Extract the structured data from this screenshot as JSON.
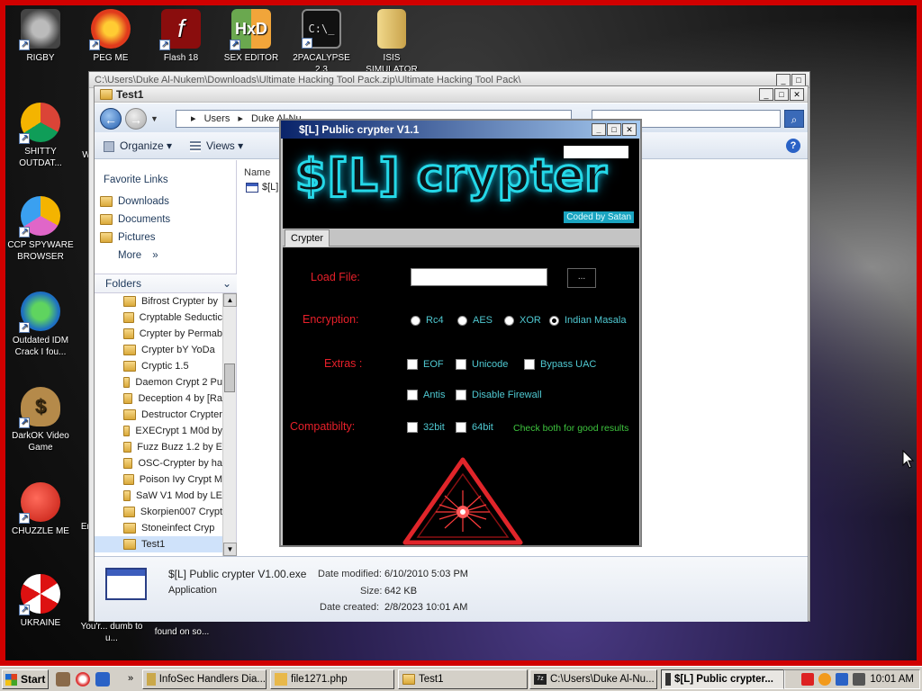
{
  "colors": {
    "desktop_border": "#d00000",
    "crypter_bg": "#000000",
    "crypter_label": "#e8202a",
    "crypter_option": "#4fc9d2",
    "crypter_hint": "#3ec53e",
    "logo_glow": "#25d8e8"
  },
  "desktop": {
    "icons": [
      {
        "label": "RIGBY",
        "icon": "raccoon-icon"
      },
      {
        "label": "PEG ME",
        "icon": "peg-icon"
      },
      {
        "label": "Flash 18",
        "icon": "flash-icon"
      },
      {
        "label": "SEX EDITOR",
        "icon": "hex-editor-icon"
      },
      {
        "label": "2PACALYPSE 2.3",
        "icon": "terminal-icon"
      },
      {
        "label": "ISIS SIMULATOR",
        "icon": "folder-icon"
      },
      {
        "label": "SHITTY OUTDAT...",
        "icon": "chrome-icon"
      },
      {
        "label": "CCP SPYWARE BROWSER",
        "icon": "chrome-canary-icon"
      },
      {
        "label": "Outdated IDM Crack I fou...",
        "icon": "idm-icon"
      },
      {
        "label": "DarkOK Video Game",
        "icon": "money-bag-icon"
      },
      {
        "label": "CHUZZLE ME",
        "icon": "chuzzle-icon"
      },
      {
        "label": "UKRAINE",
        "icon": "radiation-icon"
      },
      {
        "label": "W",
        "icon": "partial-icon"
      },
      {
        "label": "En",
        "icon": "partial-icon"
      },
      {
        "label": "You'r... dumb to u...",
        "icon": "partial-icon"
      },
      {
        "label": "found on so...",
        "icon": "partial-icon"
      }
    ]
  },
  "explorer": {
    "back_window_title": "C:\\Users\\Duke Al-Nukem\\Downloads\\Ultimate Hacking Tool Pack.zip\\Ultimate Hacking Tool Pack\\",
    "title": "Test1",
    "breadcrumb": [
      "Users",
      "Duke Al-Nu..."
    ],
    "organize_label": "Organize",
    "views_label": "Views",
    "favorite_links_title": "Favorite Links",
    "favorites": [
      "Downloads",
      "Documents",
      "Pictures"
    ],
    "more_label": "More",
    "folders_label": "Folders",
    "folders": [
      "Bifrost Crypter by",
      "Cryptable Seductic",
      "Crypter by Permab",
      "Crypter bY YoDa",
      "Cryptic 1.5",
      "Daemon Crypt 2 Pu",
      "Deception 4 by [Ra",
      "Destructor Crypter",
      "EXECrypt 1 M0d by",
      "Fuzz Buzz 1.2 by E",
      "OSC-Crypter by ha",
      "Poison Ivy Crypt M",
      "SaW V1 Mod by LE",
      "Skorpien007 Crypt",
      "Stoneinfect Cryp",
      "Test1"
    ],
    "name_column": "Name",
    "file_short_name": "$[L]",
    "details": {
      "file_name": "$[L] Public crypter V1.00.exe",
      "file_type": "Application",
      "date_modified_label": "Date modified:",
      "date_modified": "6/10/2010 5:03 PM",
      "size_label": "Size:",
      "size": "642 KB",
      "date_created_label": "Date created:",
      "date_created": "2/8/2023 10:01 AM"
    }
  },
  "crypter": {
    "title": "$[L] Public crypter V1.1",
    "logo_text": "$[L] crypter",
    "coded_by": "Coded by Satan",
    "tab": "Crypter",
    "load_file_label": "Load File:",
    "browse_label": "...",
    "encryption_label": "Encryption:",
    "encryption_options": [
      "Rc4",
      "AES",
      "XOR",
      "Indian Masala"
    ],
    "encryption_selected": "Indian Masala",
    "extras_label": "Extras :",
    "extras_row1": [
      "EOF",
      "Unicode",
      "Bypass UAC"
    ],
    "extras_row2": [
      "Antis",
      "Disable Firewall"
    ],
    "compat_label": "Compatibilty:",
    "compat_options": [
      "32bit",
      "64bit"
    ],
    "compat_hint": "Check both for good results"
  },
  "taskbar": {
    "start_label": "Start",
    "tasks": [
      {
        "label": "InfoSec Handlers Dia...",
        "active": false
      },
      {
        "label": "file1271.php",
        "active": false
      },
      {
        "label": "Test1",
        "active": false
      },
      {
        "label": "C:\\Users\\Duke Al-Nu...",
        "active": false
      },
      {
        "label": "$[L] Public crypter...",
        "active": true
      }
    ],
    "clock": "10:01 AM"
  }
}
